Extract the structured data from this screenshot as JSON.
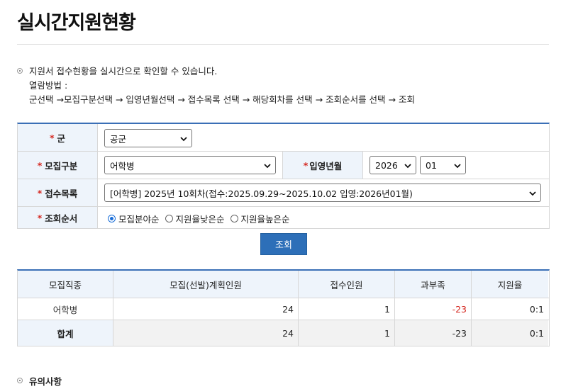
{
  "page": {
    "title": "실시간지원현황"
  },
  "info": {
    "line1": "지원서 접수현황을 실시간으로 확인할 수 있습니다.",
    "line2": "열람방법 :",
    "line3": "군선택 →모집구분선택 → 입영년월선택 → 접수목록 선택 → 해당회차를 선택 → 조회순서를 선택 → 조회"
  },
  "form": {
    "branch_label": "군",
    "branch_value": "공군",
    "recruit_type_label": "모집구분",
    "recruit_type_value": "어학병",
    "enlist_label": "입영년월",
    "enlist_year": "2026",
    "enlist_month": "01",
    "list_label": "접수목록",
    "list_value": "[어학병] 2025년 10회차(접수:2025.09.29~2025.10.02 입영:2026년01월)",
    "order_label": "조회순서",
    "order_options": [
      "모집분야순",
      "지원율낮은순",
      "지원율높은순"
    ],
    "order_selected": "모집분야순",
    "required_mark": "*"
  },
  "search_button": "조회",
  "table": {
    "headers": [
      "모집직종",
      "모집(선발)계획인원",
      "접수인원",
      "과부족",
      "지원율"
    ],
    "rows": [
      {
        "field": "어학병",
        "planned": "24",
        "applied": "1",
        "shortfall": "-23",
        "ratio": "0:1"
      }
    ],
    "total": {
      "label": "합계",
      "planned": "24",
      "applied": "1",
      "shortfall": "-23",
      "ratio": "0:1"
    }
  },
  "notice": {
    "title": "유의사항"
  },
  "colors": {
    "accent": "#2d6fb8",
    "label_bg": "#eef4fb",
    "required": "#d4261e"
  }
}
